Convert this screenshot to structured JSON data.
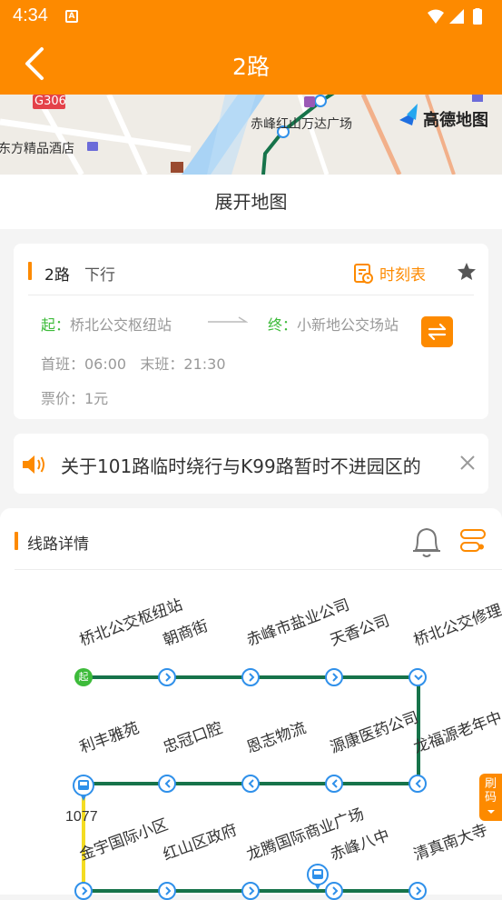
{
  "status_bar": {
    "time": "4:34",
    "notif_icon": "A"
  },
  "appbar": {
    "title": "2路"
  },
  "map": {
    "labels": {
      "g306": "G306",
      "wanda": "赤峰红山万达广场",
      "hotel": "东方精品酒店",
      "amap": "高德地图"
    },
    "expand_label": "展开地图"
  },
  "route_card": {
    "route_name": "2路",
    "direction": "下行",
    "timetable_label": "时刻表",
    "start_key": "起：",
    "start_station": "桥北公交枢纽站",
    "end_key": "终：",
    "end_station": "小新地公交场站",
    "first_bus": "首班：06:00",
    "last_bus": "末班：21:30",
    "fare": "票价：1元"
  },
  "notice": {
    "text": "关于101路临时绕行与K99路暂时不进园区的"
  },
  "details": {
    "title": "线路详情",
    "start_badge": "起",
    "bus_number": "1077",
    "side_tab": "刷码",
    "row1": [
      "桥北公交枢纽站",
      "朝商街",
      "赤峰市盐业公司",
      "天香公司",
      "桥北公交修理"
    ],
    "row2": [
      "利丰雅苑",
      "忠冠口腔",
      "恩志物流",
      "源康医药公司",
      "龙福源老年中"
    ],
    "row3": [
      "金宇国际小区",
      "红山区政府",
      "龙腾国际商业广场",
      "赤峰八中",
      "清真南大寺"
    ]
  },
  "colors": {
    "accent": "#fd8a00",
    "route_line": "#16734a",
    "node_blue": "#2f90ea",
    "start_green": "#3dbb3a",
    "bus_segment": "#f4dc22"
  }
}
